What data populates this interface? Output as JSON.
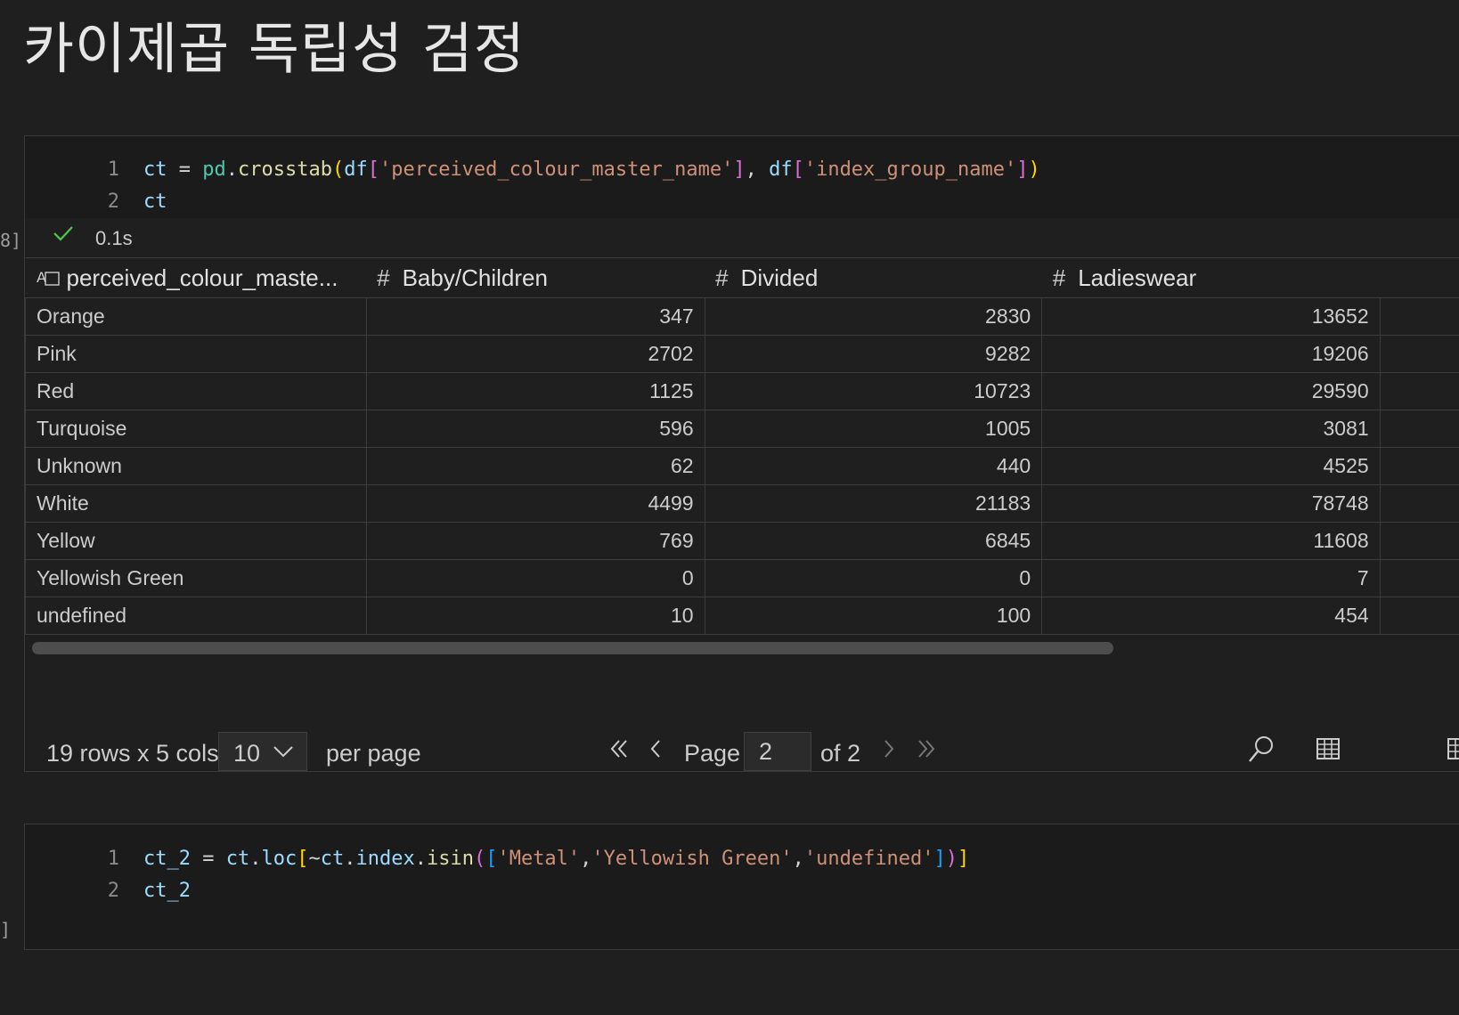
{
  "heading": "카이제곱 독립성 검정",
  "cell1": {
    "execution_count": "8]",
    "lines": [
      {
        "num": "1",
        "tokens": [
          {
            "t": "ct",
            "c": "t-var"
          },
          {
            "t": " = ",
            "c": "t-op"
          },
          {
            "t": "pd",
            "c": "t-mod"
          },
          {
            "t": ".",
            "c": "t-op"
          },
          {
            "t": "crosstab",
            "c": "t-fn"
          },
          {
            "t": "(",
            "c": "t-p1"
          },
          {
            "t": "df",
            "c": "t-var"
          },
          {
            "t": "[",
            "c": "t-p2"
          },
          {
            "t": "'perceived_colour_master_name'",
            "c": "t-str"
          },
          {
            "t": "]",
            "c": "t-p2"
          },
          {
            "t": ", ",
            "c": "t-op"
          },
          {
            "t": "df",
            "c": "t-var"
          },
          {
            "t": "[",
            "c": "t-p2"
          },
          {
            "t": "'index_group_name'",
            "c": "t-str"
          },
          {
            "t": "]",
            "c": "t-p2"
          },
          {
            "t": ")",
            "c": "t-p1"
          }
        ]
      },
      {
        "num": "2",
        "tokens": [
          {
            "t": "ct",
            "c": "t-var"
          }
        ]
      }
    ],
    "status": {
      "time": "0.1s"
    }
  },
  "table": {
    "columns": [
      "perceived_colour_maste...",
      "Baby/Children",
      "Divided",
      "Ladieswear"
    ],
    "rows": [
      [
        "Orange",
        "347",
        "2830",
        "13652"
      ],
      [
        "Pink",
        "2702",
        "9282",
        "19206"
      ],
      [
        "Red",
        "1125",
        "10723",
        "29590"
      ],
      [
        "Turquoise",
        "596",
        "1005",
        "3081"
      ],
      [
        "Unknown",
        "62",
        "440",
        "4525"
      ],
      [
        "White",
        "4499",
        "21183",
        "78748"
      ],
      [
        "Yellow",
        "769",
        "6845",
        "11608"
      ],
      [
        "Yellowish Green",
        "0",
        "0",
        "7"
      ],
      [
        "undefined",
        "10",
        "100",
        "454"
      ]
    ]
  },
  "footer": {
    "row_count": "19 rows x 5 cols",
    "page_size": "10",
    "per_page": "per page",
    "page_label": "Page",
    "page_value": "2",
    "of_label": "of 2"
  },
  "cell2": {
    "execution_count": "]",
    "lines": [
      {
        "num": "1",
        "tokens": [
          {
            "t": "ct_2",
            "c": "t-var"
          },
          {
            "t": " = ",
            "c": "t-op"
          },
          {
            "t": "ct",
            "c": "t-var"
          },
          {
            "t": ".",
            "c": "t-op"
          },
          {
            "t": "loc",
            "c": "t-var"
          },
          {
            "t": "[",
            "c": "t-p1"
          },
          {
            "t": "~",
            "c": "t-op"
          },
          {
            "t": "ct",
            "c": "t-var"
          },
          {
            "t": ".",
            "c": "t-op"
          },
          {
            "t": "index",
            "c": "t-var"
          },
          {
            "t": ".",
            "c": "t-op"
          },
          {
            "t": "isin",
            "c": "t-fn"
          },
          {
            "t": "(",
            "c": "t-p2"
          },
          {
            "t": "[",
            "c": "t-p3"
          },
          {
            "t": "'Metal'",
            "c": "t-str"
          },
          {
            "t": ",",
            "c": "t-op"
          },
          {
            "t": "'Yellowish Green'",
            "c": "t-str"
          },
          {
            "t": ",",
            "c": "t-op"
          },
          {
            "t": "'undefined'",
            "c": "t-str"
          },
          {
            "t": "]",
            "c": "t-p3"
          },
          {
            "t": ")",
            "c": "t-p2"
          },
          {
            "t": "]",
            "c": "t-p1"
          }
        ]
      },
      {
        "num": "2",
        "tokens": [
          {
            "t": "ct_2",
            "c": "t-var"
          }
        ]
      }
    ]
  },
  "icons": {
    "first": "double-chevron-left-icon",
    "prev": "chevron-left-icon",
    "next": "chevron-right-icon",
    "last": "double-chevron-right-icon",
    "search": "search-icon",
    "table": "table-icon"
  },
  "colors": {
    "background": "#1f1f1f",
    "code_bg": "#1b1b1b",
    "check": "#4ec94e",
    "border": "#3a3a3a"
  }
}
